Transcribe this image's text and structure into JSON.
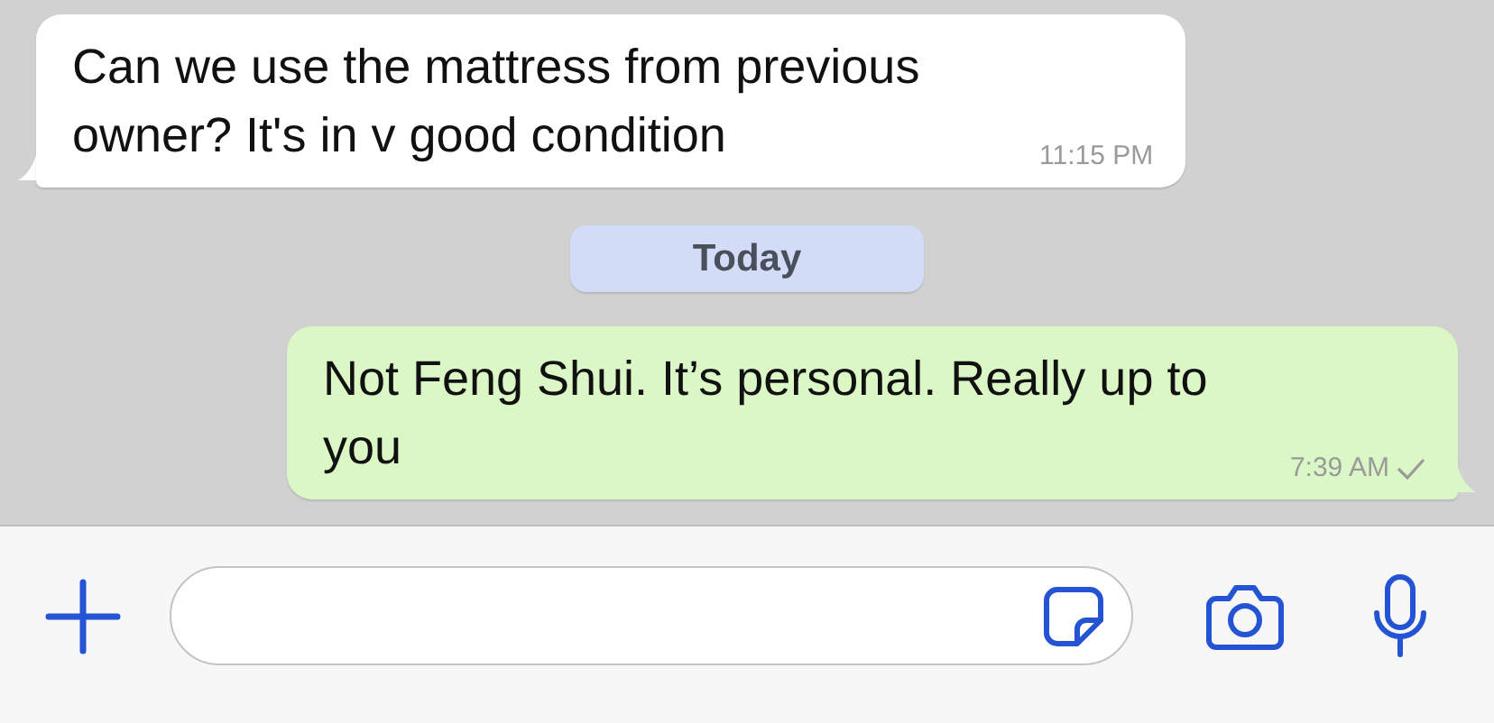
{
  "chat": [
    {
      "kind": "incoming",
      "text": "Can we use the mattress from previous owner? It's in v good condition",
      "time": "11:15 PM"
    },
    {
      "kind": "date",
      "text": "Today"
    },
    {
      "kind": "outgoing",
      "text": "Not Feng Shui. It’s personal. Really up to you",
      "time": "7:39 AM"
    }
  ]
}
